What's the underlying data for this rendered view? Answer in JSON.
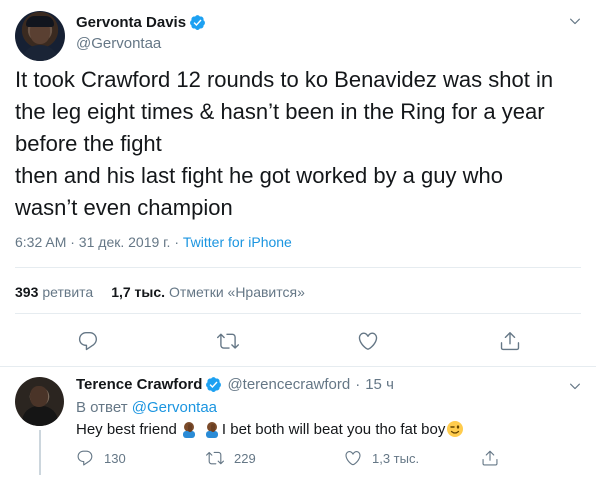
{
  "main_tweet": {
    "display_name": "Gervonta Davis",
    "handle": "@Gervontaa",
    "text": "It took Crawford 12 rounds to ko Benavidez was shot in\nthe leg eight times & hasn’t been in the Ring for a year\nbefore the fight\nthen and his last fight he got worked by a guy who\nwasn’t even champion",
    "timestamp": "6:32 AM · 31 дек. 2019 г.",
    "separator": " · ",
    "source": "Twitter for iPhone",
    "retweets_count": "393",
    "retweets_label": "ретвита",
    "likes_count": "1,7 тыс.",
    "likes_label": "Отметки «Нравится»"
  },
  "reply_tweet": {
    "display_name": "Terence Crawford",
    "handle": "@terencecrawford",
    "dot": "·",
    "time": "15 ч",
    "reply_prefix": "В ответ",
    "reply_mention": "@Gervontaa",
    "text_part1": "Hey best friend",
    "text_part2": " I bet both will beat you tho fat boy",
    "replies_count": "130",
    "retweets_count": "229",
    "likes_count": "1,3 тыс."
  },
  "colors": {
    "accent": "#1b95e0",
    "verified": "#1da1f2",
    "muted": "#657786",
    "text": "#14171a",
    "divider": "#e6ecf0"
  },
  "icons": {
    "verified": "verified-badge-icon",
    "caret": "chevron-down-icon",
    "reply": "reply-icon",
    "retweet": "retweet-icon",
    "like": "heart-icon",
    "share": "share-icon"
  }
}
